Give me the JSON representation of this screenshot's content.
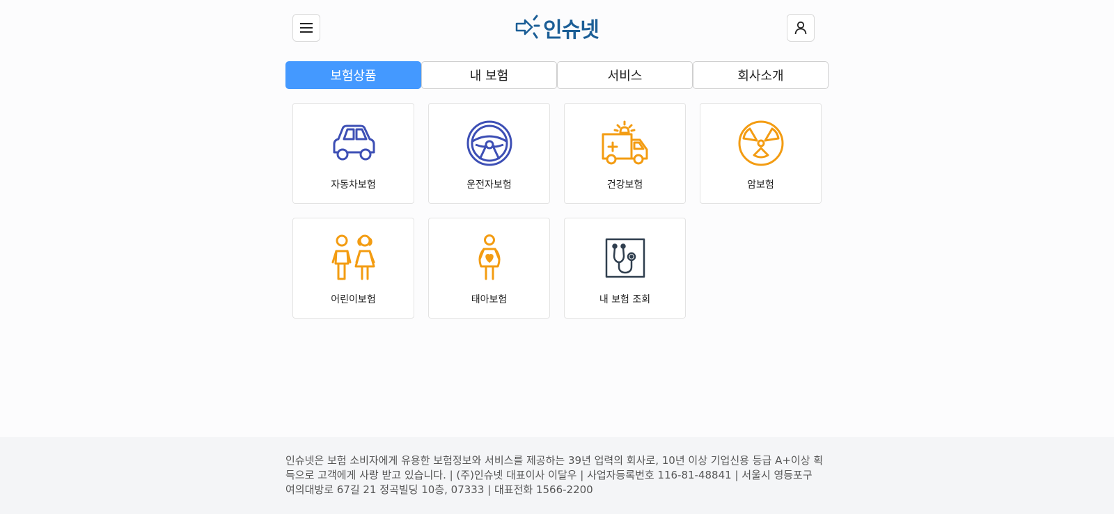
{
  "header": {
    "logo_text": "인슈넷"
  },
  "tabs": [
    {
      "label": "보험상품",
      "active": true
    },
    {
      "label": "내 보험",
      "active": false
    },
    {
      "label": "서비스",
      "active": false
    },
    {
      "label": "회사소개",
      "active": false
    }
  ],
  "products": [
    {
      "label": "자동차보험",
      "icon": "car-icon",
      "color": "#3d4fb5"
    },
    {
      "label": "운전자보험",
      "icon": "steering-wheel-icon",
      "color": "#3d4fb5"
    },
    {
      "label": "건강보험",
      "icon": "ambulance-icon",
      "color": "#f39c12"
    },
    {
      "label": "암보험",
      "icon": "radiation-icon",
      "color": "#f39c12"
    },
    {
      "label": "어린이보험",
      "icon": "children-icon",
      "color": "#f39c12"
    },
    {
      "label": "태아보험",
      "icon": "pregnant-woman-icon",
      "color": "#f39c12"
    },
    {
      "label": "내 보험 조회",
      "icon": "stethoscope-icon",
      "color": "#2f3e4e"
    }
  ],
  "footer": {
    "text": "인슈넷은 보험 소비자에게 유용한 보험정보와 서비스를 제공하는 39년 업력의 회사로, 10년 이상 기업신용 등급 A+이상 획득으로 고객에게 사랑 받고 있습니다. | (주)인슈넷 대표이사 이달우 | 사업자등록번호 116-81-48841 | 서울시 영등포구 여의대방로 67길 21 정곡빌딩 10층, 07333 | 대표전화 1566-2200"
  },
  "colors": {
    "accent": "#4499ff",
    "logo": "#1b5e96"
  }
}
